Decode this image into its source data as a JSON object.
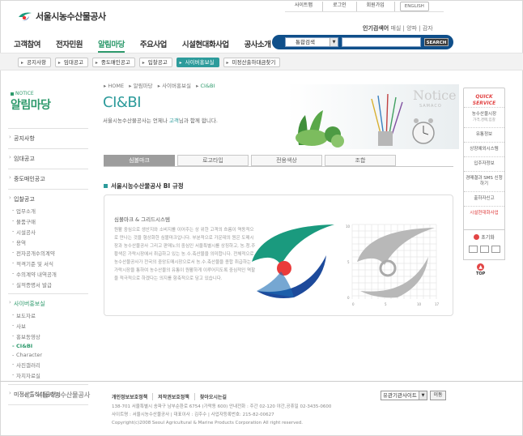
{
  "brand": {
    "name": "서울시농수산물공사",
    "footer_name": "서울시농수산물공사"
  },
  "topnav": [
    "사이트맵",
    "로그인",
    "회원가입",
    "ENGLISH"
  ],
  "popular": {
    "label": "인기검색어",
    "terms": "매실 | 양파 | 감자"
  },
  "gnb": [
    "고객참여",
    "전자민원",
    "알림마당",
    "주요사업",
    "시설현대화사업",
    "공사소개"
  ],
  "search": {
    "category": "통합검색",
    "button": "SEARCH"
  },
  "subnav": [
    "공지사항",
    "임대공고",
    "중도매인공고",
    "입찰공고",
    "사이버홍보실",
    "미정산출하대금찾기"
  ],
  "lnb": {
    "notice": "NOTICE",
    "title": "알림마당",
    "groups": [
      {
        "label": "공지사항",
        "subs": []
      },
      {
        "label": "임대공고",
        "subs": []
      },
      {
        "label": "중도매인공고",
        "subs": []
      },
      {
        "label": "입찰공고",
        "subs": [
          "업무소개",
          "물품구매",
          "시설공사",
          "용역",
          "전자공개수의계약",
          "적격기준 및 서식",
          "수의계약 내역공개",
          "실적증명서 발급"
        ]
      },
      {
        "label": "사이버홍보실",
        "subs": [
          "보도자료",
          "사보",
          "홍보동영상",
          "CI&BI",
          "Character",
          "사진갤러리",
          "자치자료실"
        ]
      },
      {
        "label": "미정산출하대금찾기",
        "subs": []
      }
    ]
  },
  "breadcrumb": [
    "HOME",
    "알림마당",
    "사이버홍보실",
    "CI&BI"
  ],
  "page": {
    "title": "CI&BI",
    "desc_pre": "서울시농수산물공사는 언제나 ",
    "desc_hl": "고객",
    "desc_post": "님과 함께 합니다.",
    "notice_word": "Notice",
    "notice_sub": "SAMACO"
  },
  "tabs": [
    "심볼마크",
    "로고타입",
    "전용색상",
    "조합"
  ],
  "section": {
    "title": "서울시농수산물공사 BI 규정",
    "label": "심볼마크 & 그리드시스템",
    "paragraph": "원활 중심으로 생산지와 소비지를 이어주는 상 위한 고객의 흐름이 역동적으로 만나는 것을 형상화한 심볼마크입니다. 부분적으로 가운데의 원은 도매시장과 농수산물공사 그리고 판매노의 중심인 서울특별시를 상징하고, 농.청.주황색은 가락시장에서 취급하고 있는 농.수.축산물을 의미합니다. 전체적으로 농수산물공사가 전국의 중앙도매시장으로서 농.수.축산물을 종합 취급하는 가락시장을 통하여 농수산물의 유통이 원활하게 이루어지도록 중심적인 역할을 적극적으로 하겠다는 의지를 함축적으로 담고 있습니다.",
    "grid_ticks_y": [
      "10",
      "5",
      "0"
    ],
    "grid_ticks_x": [
      "0",
      "5",
      "10",
      "17"
    ]
  },
  "quick": {
    "title1": "QUICK",
    "title2": "SERVICE",
    "items": [
      {
        "label": "농수산물시장",
        "small": "가격,경매,입찰"
      },
      {
        "label": "유통정보",
        "small": ""
      },
      {
        "label": "상장예외시스템",
        "small": ""
      },
      {
        "label": "입주자정보",
        "small": ""
      },
      {
        "label": "경매결과 SMS 신청하기",
        "small": ""
      },
      {
        "label": "출하자신고",
        "small": ""
      },
      {
        "label": "시설현대화사업",
        "small": ""
      }
    ],
    "reset": "초기화",
    "top": "TOP"
  },
  "footer": {
    "links": [
      "개인정보보호정책",
      "저작권보호정책",
      "찾아오시는길"
    ],
    "addr1": "138-701 서울특별시 송파구 남부순환로 6754 (가락동 600) 안내전화 : 주간 02-120  야간,공휴일 02-3435-0600",
    "addr2": "사이트명 : 서울시농수산물공사  |  대표이사 : 김주수  |  사업자등록번호: 215-82-00627",
    "copy": "Copyright(c)2008 Seoul Agricultural & Marine Products Corporation All right reserved.",
    "select": "유관기관사이트",
    "go": "이동"
  },
  "colors": {
    "accent": "#2d9b9b",
    "green": "#2e9a6c",
    "navy": "#0f4f8a",
    "red": "#e24545"
  }
}
